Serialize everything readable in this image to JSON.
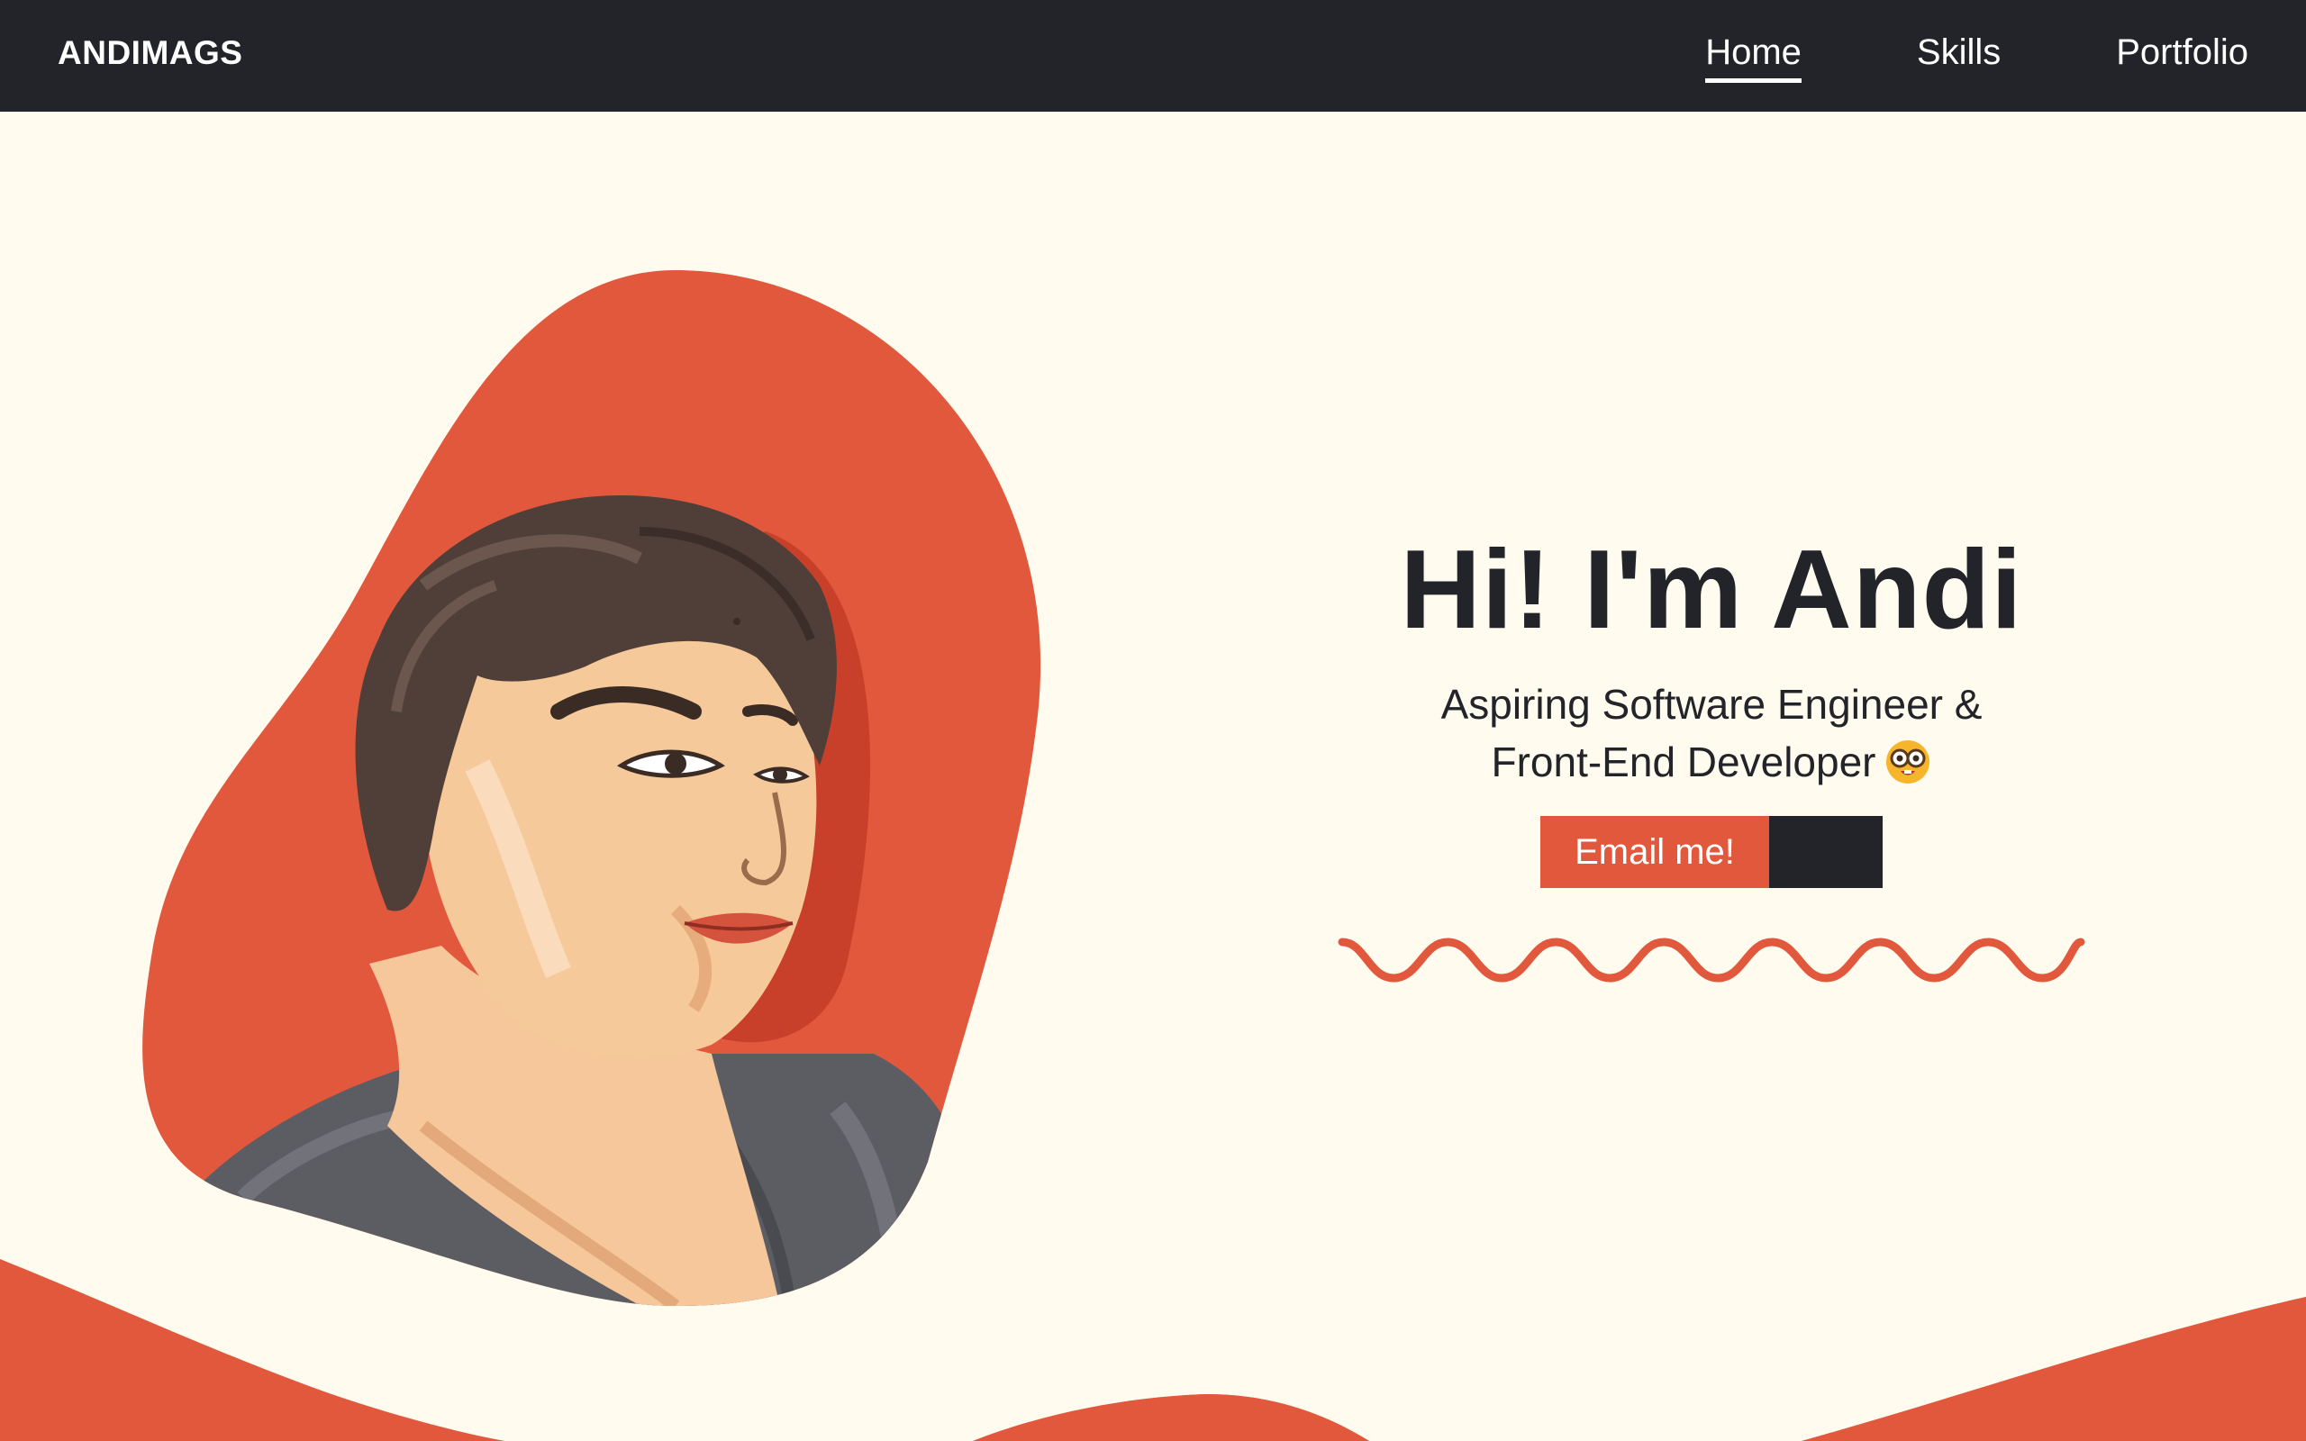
{
  "navbar": {
    "brand": "ANDIMAGS",
    "links": [
      {
        "label": "Home",
        "active": true
      },
      {
        "label": "Skills",
        "active": false
      },
      {
        "label": "Portfolio",
        "active": false
      }
    ]
  },
  "hero": {
    "title": "Hi! I'm Andi",
    "subtitle_line1": "Aspiring Software Engineer &",
    "subtitle_line2": "Front-End Developer",
    "cta_label": "Email me!"
  },
  "colors": {
    "accent": "#e2583d",
    "dark": "#222429",
    "background": "#fffbef"
  },
  "icons": {
    "subtitle_emoji": "nerd-face-emoji-icon"
  }
}
